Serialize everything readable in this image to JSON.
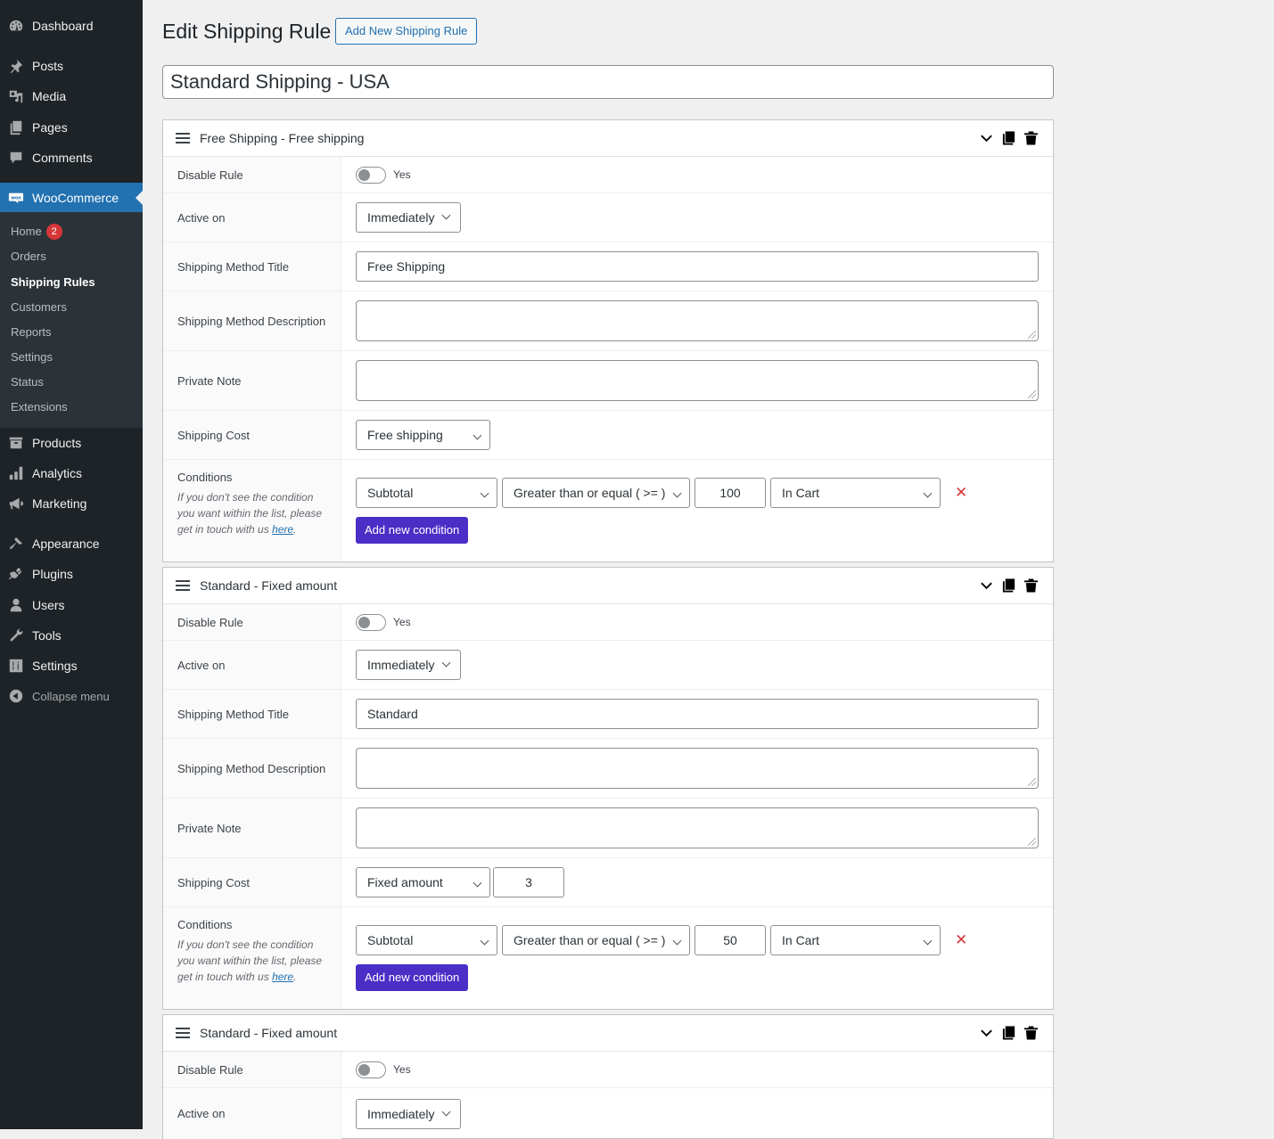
{
  "sidebar": {
    "items": [
      {
        "label": "Dashboard",
        "icon": "dashboard-icon"
      },
      {
        "label": "Posts",
        "icon": "pin-icon"
      },
      {
        "label": "Media",
        "icon": "media-icon"
      },
      {
        "label": "Pages",
        "icon": "pages-icon"
      },
      {
        "label": "Comments",
        "icon": "comment-icon"
      },
      {
        "label": "WooCommerce",
        "icon": "woo-icon"
      },
      {
        "label": "Products",
        "icon": "archive-icon"
      },
      {
        "label": "Analytics",
        "icon": "bar-chart-icon"
      },
      {
        "label": "Marketing",
        "icon": "megaphone-icon"
      },
      {
        "label": "Appearance",
        "icon": "paintbrush-icon"
      },
      {
        "label": "Plugins",
        "icon": "plug-icon"
      },
      {
        "label": "Users",
        "icon": "user-icon"
      },
      {
        "label": "Tools",
        "icon": "wrench-icon"
      },
      {
        "label": "Settings",
        "icon": "sliders-icon"
      },
      {
        "label": "Collapse menu",
        "icon": "collapse-icon"
      }
    ],
    "submenu": [
      {
        "label": "Home",
        "badge": "2"
      },
      {
        "label": "Orders"
      },
      {
        "label": "Shipping Rules"
      },
      {
        "label": "Customers"
      },
      {
        "label": "Reports"
      },
      {
        "label": "Settings"
      },
      {
        "label": "Status"
      },
      {
        "label": "Extensions"
      }
    ]
  },
  "header": {
    "title": "Edit Shipping Rule",
    "add_new_label": "Add New Shipping Rule",
    "rule_name": "Standard Shipping - USA"
  },
  "labels": {
    "disable_rule": "Disable Rule",
    "yes": "Yes",
    "active_on": "Active on",
    "method_title": "Shipping Method Title",
    "method_description": "Shipping Method Description",
    "private_note": "Private Note",
    "shipping_cost": "Shipping Cost",
    "conditions": "Conditions",
    "conditions_help": "If you don't see the condition you want within the list, please get in touch with us",
    "conditions_link": "here",
    "add_condition": "Add new condition"
  },
  "rules": [
    {
      "title": "Free Shipping - Free shipping",
      "active_on": "Immediately",
      "method_title": "Free Shipping",
      "method_description": "",
      "private_note": "",
      "cost_type": "Free shipping",
      "cost_value": null,
      "conditions": [
        {
          "field": "Subtotal",
          "operator": "Greater than or equal ( >= )",
          "value": "100",
          "scope": "In Cart"
        }
      ]
    },
    {
      "title": "Standard - Fixed amount",
      "active_on": "Immediately",
      "method_title": "Standard",
      "method_description": "",
      "private_note": "",
      "cost_type": "Fixed amount",
      "cost_value": "3",
      "conditions": [
        {
          "field": "Subtotal",
          "operator": "Greater than or equal ( >= )",
          "value": "50",
          "scope": "In Cart"
        }
      ]
    },
    {
      "title": "Standard - Fixed amount",
      "active_on": "Immediately"
    }
  ]
}
